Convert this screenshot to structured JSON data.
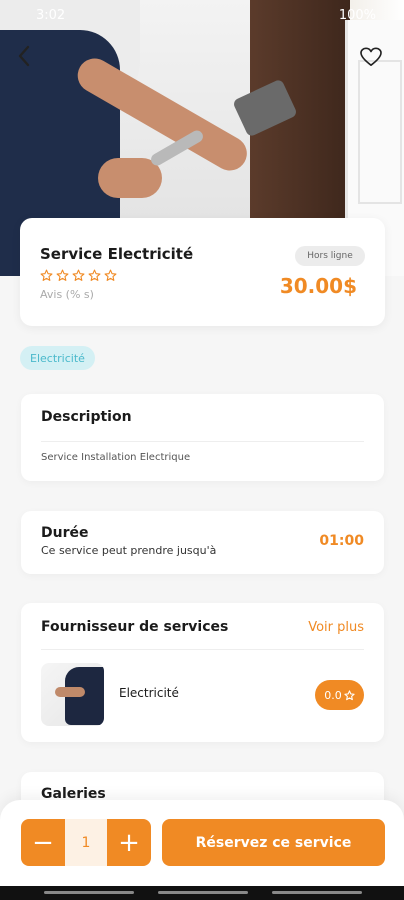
{
  "status_bar": {
    "time": "3:02",
    "right": "100%"
  },
  "service": {
    "title": "Service Electricité",
    "rating": 0,
    "max_rating": 5,
    "reviews": "Avis (% s)",
    "status": "Hors ligne",
    "price": "30.00$"
  },
  "category": "Electricité",
  "description": {
    "title": "Description",
    "text": "Service Installation Electrique"
  },
  "duration": {
    "title": "Durée",
    "subtitle": "Ce service peut prendre jusqu'à",
    "value": "01:00"
  },
  "provider": {
    "title": "Fournisseur de services",
    "more": "Voir plus",
    "name": "Electricité",
    "rating": "0.0"
  },
  "gallery": {
    "title": "Galeries"
  },
  "booking": {
    "quantity": "1",
    "minus": "−",
    "plus": "+",
    "button": "Réservez ce service"
  },
  "colors": {
    "accent": "#f08a24",
    "chip_bg": "#d4f0f4",
    "chip_text": "#4ab9cb"
  }
}
